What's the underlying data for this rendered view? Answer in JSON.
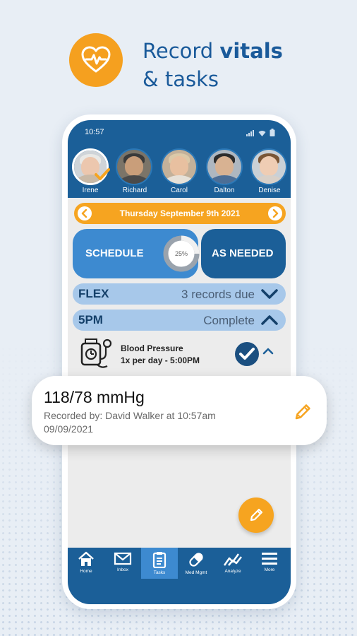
{
  "header": {
    "title_line1_normal": "Record ",
    "title_line1_bold": "vitals",
    "title_line2": "& tasks",
    "icon": "heart-pulse-icon"
  },
  "status_bar": {
    "time": "10:57"
  },
  "residents": [
    {
      "name": "Irene",
      "active": true
    },
    {
      "name": "Richard",
      "active": false
    },
    {
      "name": "Carol",
      "active": false
    },
    {
      "name": "Dalton",
      "active": false
    },
    {
      "name": "Denise",
      "active": false
    }
  ],
  "date_bar": {
    "label": "Thursday September 9th 2021"
  },
  "tabs": {
    "schedule": "SCHEDULE",
    "schedule_progress_label": "25%",
    "schedule_progress": 0.25,
    "as_needed": "AS NEEDED"
  },
  "rows": [
    {
      "label": "FLEX",
      "status": "3 records due",
      "expanded": false
    },
    {
      "label": "5PM",
      "status": "Complete",
      "expanded": true
    }
  ],
  "task": {
    "title": "Blood Pressure",
    "frequency": "1x per day - 5:00PM",
    "completed": true
  },
  "record_card": {
    "value": "118/78 mmHg",
    "recorded_by": "Recorded by: David Walker at 10:57am",
    "date": "09/09/2021"
  },
  "bottom_nav": [
    {
      "label": "Home",
      "icon": "home-icon"
    },
    {
      "label": "Inbox",
      "icon": "envelope-icon"
    },
    {
      "label": "Tasks",
      "icon": "clipboard-icon",
      "active": true
    },
    {
      "label": "Med Mgmt",
      "icon": "pill-icon"
    },
    {
      "label": "Analyze",
      "icon": "chart-icon"
    },
    {
      "label": "More",
      "icon": "menu-icon"
    }
  ],
  "colors": {
    "primary_dark": "#1b5f98",
    "primary_light": "#3d8ad0",
    "accent_orange": "#f6a420",
    "row_background": "#a7c8ea"
  }
}
